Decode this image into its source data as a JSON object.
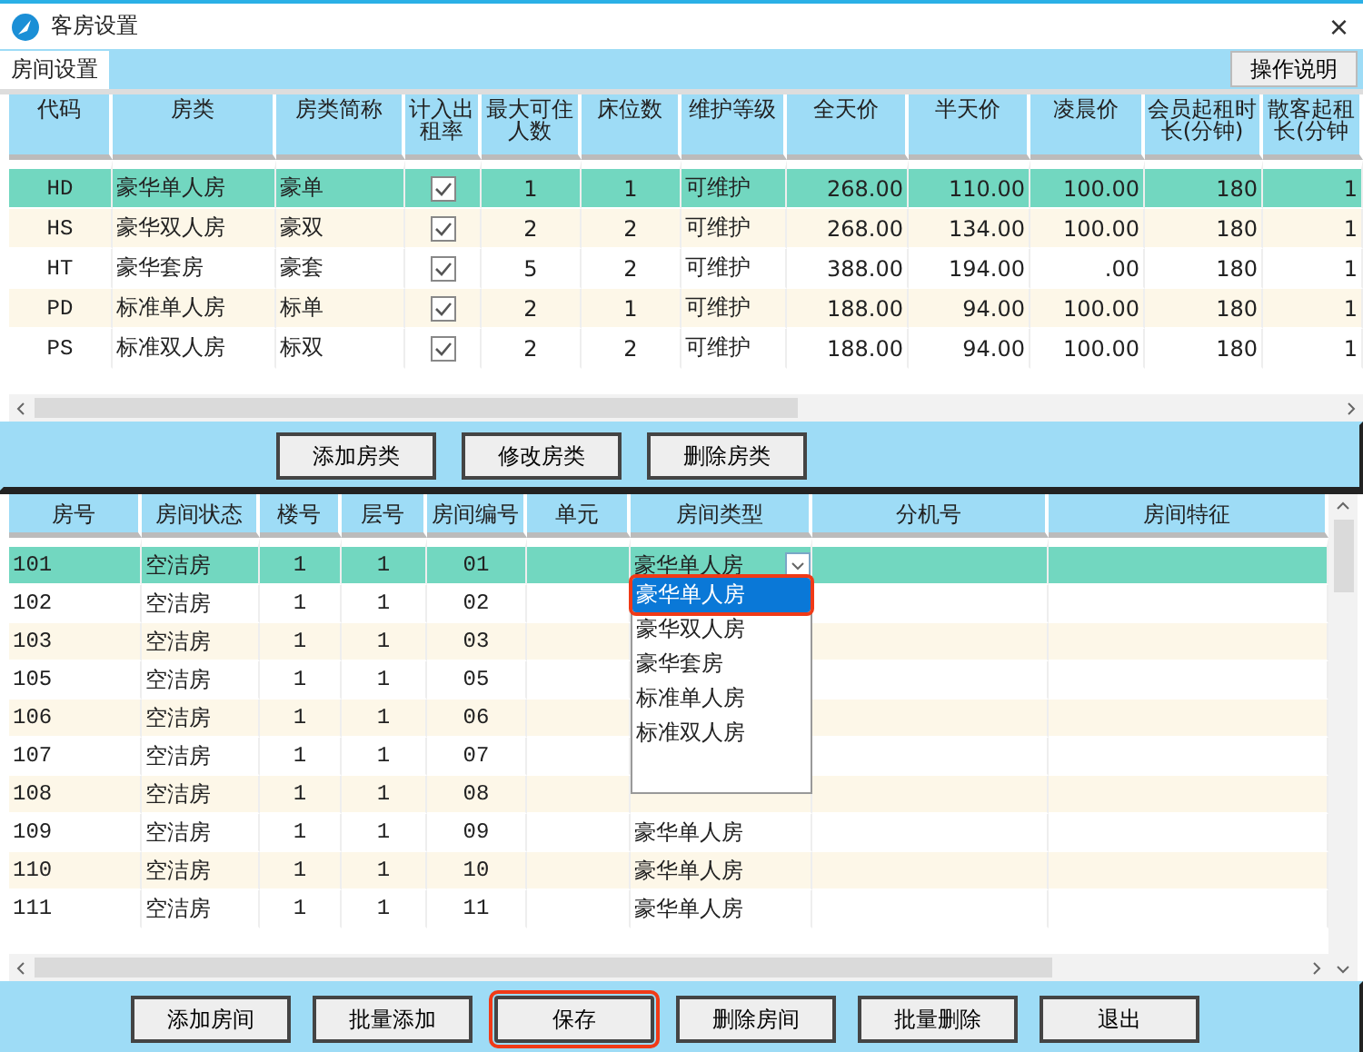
{
  "window": {
    "title": "客房设置",
    "close": "×"
  },
  "tabs": [
    {
      "label": "房间设置",
      "selected": true
    }
  ],
  "help_button": "操作说明",
  "room_types": {
    "columns": [
      "代码",
      "房类",
      "房类简称",
      "计入出租率",
      "最大可住人数",
      "床位数",
      "维护等级",
      "全天价",
      "半天价",
      "凌晨价",
      "会员起租时长(分钟)",
      "散客起租长(分钟"
    ],
    "rows": [
      {
        "code": "HD",
        "name": "豪华单人房",
        "short_name": "豪单",
        "counts_toward_rent": true,
        "max_occupancy": "1",
        "beds": "1",
        "maintenance": "可维护",
        "full_day": "268.00",
        "half_day": "110.00",
        "early_morning": "100.00",
        "member_minutes": "180",
        "walkin_minutes": "1",
        "selected": true
      },
      {
        "code": "HS",
        "name": "豪华双人房",
        "short_name": "豪双",
        "counts_toward_rent": true,
        "max_occupancy": "2",
        "beds": "2",
        "maintenance": "可维护",
        "full_day": "268.00",
        "half_day": "134.00",
        "early_morning": "100.00",
        "member_minutes": "180",
        "walkin_minutes": "1",
        "selected": false
      },
      {
        "code": "HT",
        "name": "豪华套房",
        "short_name": "豪套",
        "counts_toward_rent": true,
        "max_occupancy": "5",
        "beds": "2",
        "maintenance": "可维护",
        "full_day": "388.00",
        "half_day": "194.00",
        "early_morning": ".00",
        "member_minutes": "180",
        "walkin_minutes": "1",
        "selected": false
      },
      {
        "code": "PD",
        "name": "标准单人房",
        "short_name": "标单",
        "counts_toward_rent": true,
        "max_occupancy": "2",
        "beds": "1",
        "maintenance": "可维护",
        "full_day": "188.00",
        "half_day": "94.00",
        "early_morning": "100.00",
        "member_minutes": "180",
        "walkin_minutes": "1",
        "selected": false
      },
      {
        "code": "PS",
        "name": "标准双人房",
        "short_name": "标双",
        "counts_toward_rent": true,
        "max_occupancy": "2",
        "beds": "2",
        "maintenance": "可维护",
        "full_day": "188.00",
        "half_day": "94.00",
        "early_morning": "100.00",
        "member_minutes": "180",
        "walkin_minutes": "1",
        "selected": false
      }
    ]
  },
  "type_buttons": [
    "添加房类",
    "修改房类",
    "删除房类"
  ],
  "rooms": {
    "columns": [
      "房号",
      "房间状态",
      "楼号",
      "层号",
      "房间编号",
      "单元",
      "房间类型",
      "分机号",
      "房间特征"
    ],
    "rows": [
      {
        "room": "101",
        "status": "空洁房",
        "building": "1",
        "floor": "1",
        "number": "01",
        "room_type": "豪华单人房",
        "editing": true,
        "selected": true
      },
      {
        "room": "102",
        "status": "空洁房",
        "building": "1",
        "floor": "1",
        "number": "02",
        "editing": false,
        "selected": false
      },
      {
        "room": "103",
        "status": "空洁房",
        "building": "1",
        "floor": "1",
        "number": "03",
        "editing": false,
        "selected": false
      },
      {
        "room": "105",
        "status": "空洁房",
        "building": "1",
        "floor": "1",
        "number": "05",
        "editing": false,
        "selected": false
      },
      {
        "room": "106",
        "status": "空洁房",
        "building": "1",
        "floor": "1",
        "number": "06",
        "editing": false,
        "selected": false
      },
      {
        "room": "107",
        "status": "空洁房",
        "building": "1",
        "floor": "1",
        "number": "07",
        "editing": false,
        "selected": false
      },
      {
        "room": "108",
        "status": "空洁房",
        "building": "1",
        "floor": "1",
        "number": "08",
        "editing": false,
        "selected": false
      },
      {
        "room": "109",
        "status": "空洁房",
        "building": "1",
        "floor": "1",
        "number": "09",
        "room_type": "豪华单人房",
        "editing": false,
        "selected": false
      },
      {
        "room": "110",
        "status": "空洁房",
        "building": "1",
        "floor": "1",
        "number": "10",
        "room_type": "豪华单人房",
        "editing": false,
        "selected": false
      },
      {
        "room": "111",
        "status": "空洁房",
        "building": "1",
        "floor": "1",
        "number": "11",
        "room_type": "豪华单人房",
        "editing": false,
        "selected": false
      }
    ],
    "dropdown_options": [
      {
        "label": "豪华单人房",
        "selected": true,
        "outlined": true
      },
      {
        "label": "豪华双人房",
        "selected": false,
        "outlined": false
      },
      {
        "label": "豪华套房",
        "selected": false,
        "outlined": false
      },
      {
        "label": "标准单人房",
        "selected": false,
        "outlined": false
      },
      {
        "label": "标准双人房",
        "selected": false,
        "outlined": false
      }
    ]
  },
  "room_buttons": [
    {
      "label": "添加房间",
      "outlined": false
    },
    {
      "label": "批量添加",
      "outlined": false
    },
    {
      "label": "保存",
      "outlined": true
    },
    {
      "label": "删除房间",
      "outlined": false
    },
    {
      "label": "批量删除",
      "outlined": false
    },
    {
      "label": "退出",
      "outlined": false
    }
  ]
}
